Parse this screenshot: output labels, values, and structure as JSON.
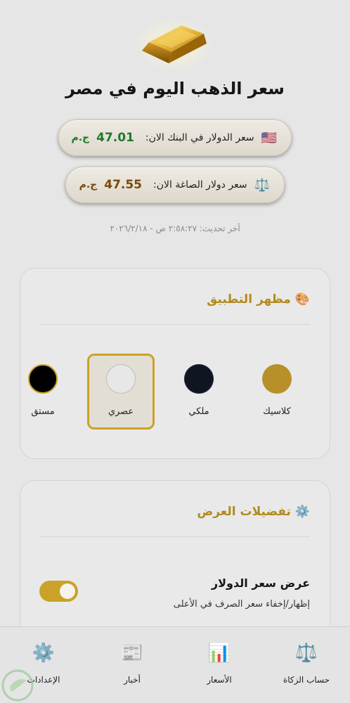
{
  "header": {
    "title": "سعر الذهب اليوم في مصر",
    "bank_rate": {
      "flag_icon": "🇺🇸",
      "label": "سعر الدولار في البنك الان:",
      "value": "47.01",
      "currency": "ج.م",
      "color": "#1d7a2a"
    },
    "goldsmith_rate": {
      "icon": "⚖️",
      "label": "سعر دولار الصاغة الان:",
      "value": "47.55",
      "currency": "ج.م",
      "color": "#7a4a0a"
    },
    "last_updated": "آخر تحديث: ٢:٥٨:٢٧ ص - ٢٠٢٦/٢/١٨"
  },
  "theme_card": {
    "icon": "🎨",
    "title": "مظهر التطبيق",
    "themes": [
      {
        "label": "كلاسيك",
        "color": "#b8902a",
        "selected": false
      },
      {
        "label": "ملكي",
        "color": "#101522",
        "selected": false
      },
      {
        "label": "عصري",
        "color": "#e7e7e7",
        "selected": true
      },
      {
        "label": "مستق",
        "color": "#000000",
        "selected": false
      }
    ],
    "accent": "#c9a227"
  },
  "display_card": {
    "icon": "⚙️",
    "title": "تفضيلات العرض",
    "option_title": "عرض سعر الدولار",
    "option_subtitle": "إظهار/إخفاء سعر الصرف في الأعلى",
    "toggle_on": true
  },
  "bottom_nav": [
    {
      "label": "حساب الزكاة",
      "icon": "⚖️"
    },
    {
      "label": "الأسعار",
      "icon": "📊"
    },
    {
      "label": "أخبار",
      "icon": "📰"
    },
    {
      "label": "الإعدادات",
      "icon": "⚙️"
    }
  ]
}
